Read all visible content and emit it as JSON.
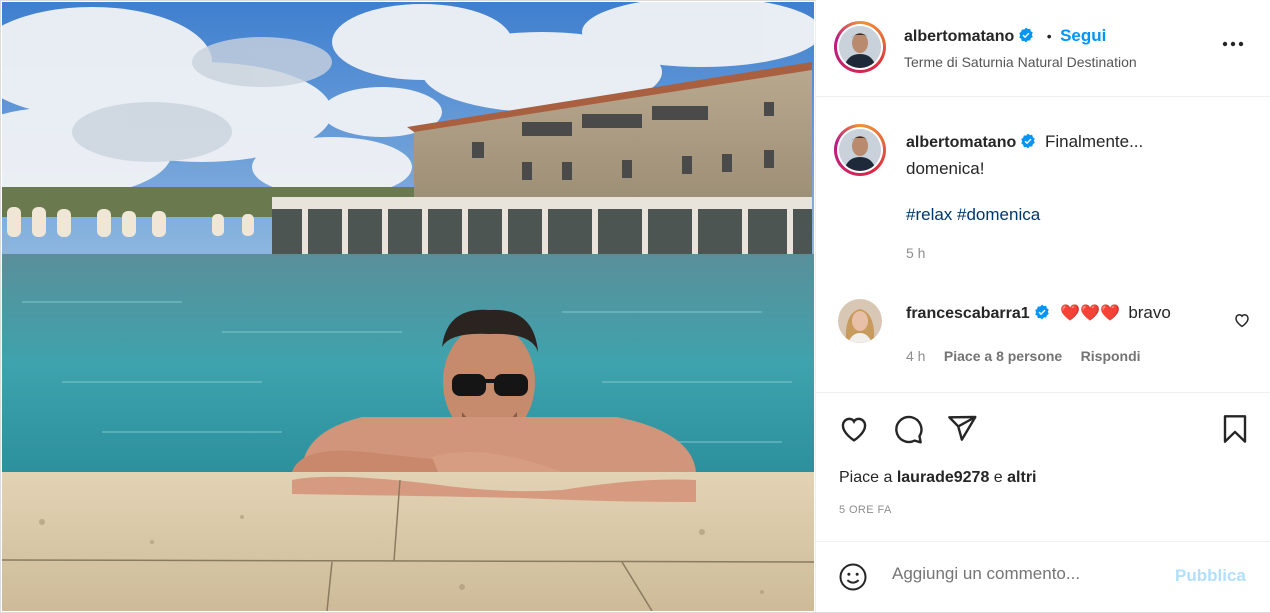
{
  "post": {
    "author": "albertomatano",
    "follow_label": "Segui",
    "separator": "•",
    "location": "Terme di Saturnia Natural Destination",
    "caption": "Finalmente... domenica!",
    "caption_line1": "Finalmente...",
    "caption_line2": "domenica!",
    "hashtags": "#relax #domenica",
    "caption_time": "5 h"
  },
  "comment": {
    "author": "francescabarra1",
    "emoji": "❤️❤️❤️",
    "text": "bravo",
    "time": "4 h",
    "likes_label": "Piace a 8 persone",
    "reply_label": "Rispondi"
  },
  "likes": {
    "prefix": "Piace a",
    "user": "laurade9278",
    "connector": "e",
    "others": "altri"
  },
  "timestamp": "5 ORE FA",
  "add_comment": {
    "placeholder": "Aggiungi un commento...",
    "publish_label": "Pubblica"
  },
  "colors": {
    "accent": "#0095f6",
    "publish_disabled": "#b2dffc",
    "heart_red": "#ed4956",
    "hashtag": "#00376b"
  },
  "icons": [
    "verified-badge-icon",
    "more-options-icon",
    "heart-icon",
    "comment-icon",
    "share-icon",
    "bookmark-icon",
    "emoji-icon",
    "small-heart-icon"
  ]
}
